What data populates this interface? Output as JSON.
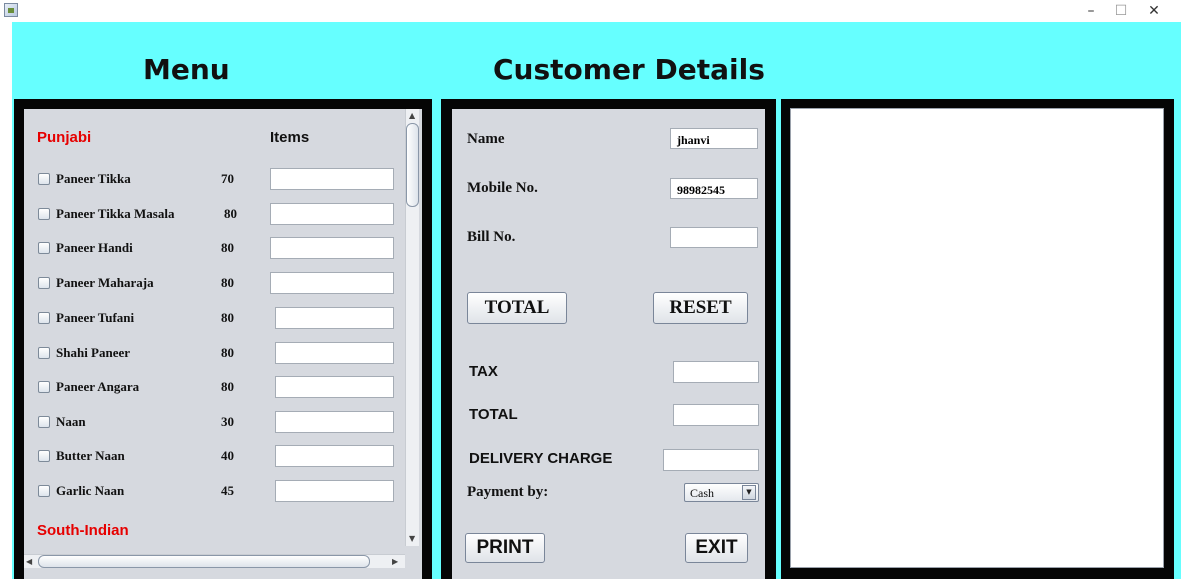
{
  "window": {
    "minimize": "–",
    "maximize": "☐",
    "close": "✕"
  },
  "headings": {
    "menu": "Menu",
    "customer": "Customer Details"
  },
  "menu": {
    "category": "Punjabi",
    "items_header": "Items",
    "next_category": "South-Indian",
    "items": [
      {
        "label": "Paneer Tikka",
        "price": "70",
        "qty": ""
      },
      {
        "label": "Paneer Tikka Masala",
        "price": "80",
        "qty": ""
      },
      {
        "label": "Paneer Handi",
        "price": "80",
        "qty": ""
      },
      {
        "label": "Paneer Maharaja",
        "price": "80",
        "qty": ""
      },
      {
        "label": "Paneer Tufani",
        "price": "80",
        "qty": ""
      },
      {
        "label": "Shahi Paneer",
        "price": "80",
        "qty": ""
      },
      {
        "label": "Paneer Angara",
        "price": "80",
        "qty": ""
      },
      {
        "label": "Naan",
        "price": "30",
        "qty": ""
      },
      {
        "label": "Butter Naan",
        "price": "40",
        "qty": ""
      },
      {
        "label": "Garlic Naan",
        "price": "45",
        "qty": ""
      }
    ]
  },
  "customer": {
    "name_label": "Name",
    "name_value": "jhanvi",
    "mobile_label": "Mobile No.",
    "mobile_value": "98982545",
    "bill_label": "Bill No.",
    "bill_value": "",
    "total_button": "TOTAL",
    "reset_button": "RESET",
    "tax_label": "TAX",
    "tax_value": "",
    "total_label": "TOTAL",
    "total_value": "",
    "delivery_label": "DELIVERY CHARGE",
    "delivery_value": "",
    "payment_label": "Payment by:",
    "payment_selected": "Cash",
    "print_button": "PRINT",
    "exit_button": "EXIT"
  },
  "bill": {
    "text": ""
  },
  "colors": {
    "background": "#66ffff",
    "panel_border": "#050505",
    "panel_fill": "#d6d9df",
    "category_red": "#e60000"
  },
  "icons": [
    "app-icon",
    "chevron-down-icon",
    "scroll-up-arrow-icon",
    "scroll-down-arrow-icon",
    "scroll-left-arrow-icon",
    "scroll-right-arrow-icon"
  ]
}
